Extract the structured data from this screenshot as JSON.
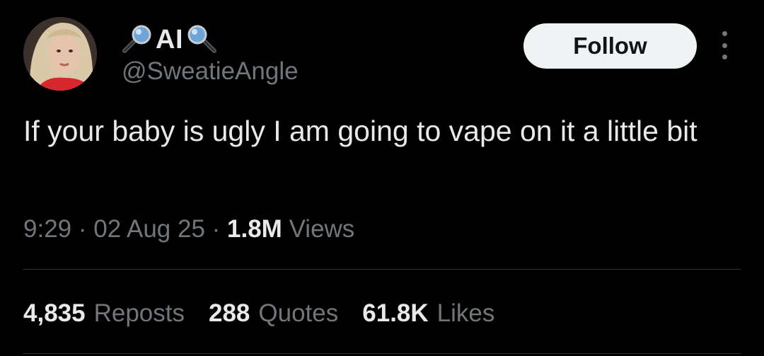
{
  "user": {
    "display_name": "AI",
    "handle": "@SweatieAngle",
    "name_icons": [
      "magnifying-glass-left",
      "magnifying-glass-right"
    ]
  },
  "actions": {
    "follow_label": "Follow",
    "more_icon": "vertical-ellipsis"
  },
  "tweet": {
    "text": "If your baby is ugly I am going to vape on it a little bit",
    "time": "9:29",
    "date": "02 Aug 25",
    "views_count": "1.8M",
    "views_label": "Views",
    "separator": "·"
  },
  "stats": {
    "reposts_count": "4,835",
    "reposts_label": "Reposts",
    "quotes_count": "288",
    "quotes_label": "Quotes",
    "likes_count": "61.8K",
    "likes_label": "Likes"
  },
  "colors": {
    "background": "#000000",
    "text_primary": "#e7e9ea",
    "text_secondary": "#71767b",
    "button_bg": "#eff3f4",
    "button_text": "#0f1419",
    "divider": "#2f3336"
  }
}
